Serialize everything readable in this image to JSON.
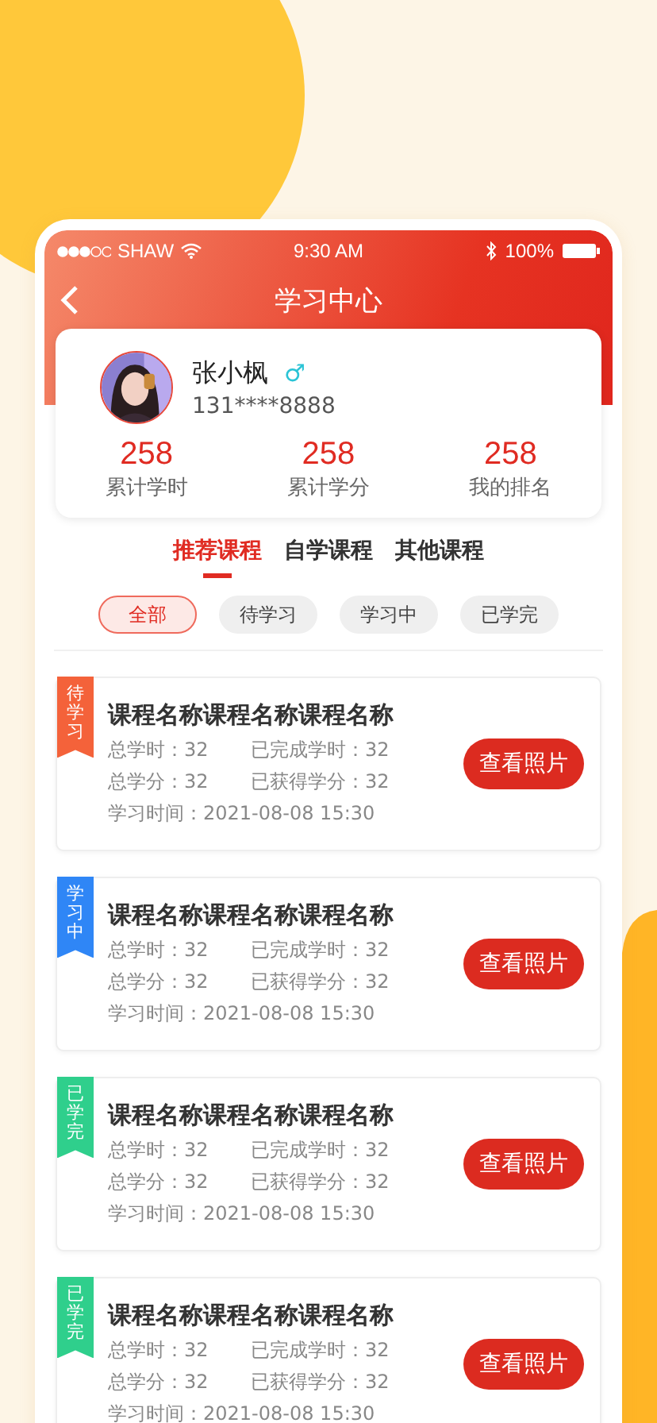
{
  "status_bar": {
    "carrier": "SHAW",
    "time": "9:30 AM",
    "battery": "100%"
  },
  "header": {
    "title": "学习中心"
  },
  "profile": {
    "name": "张小枫",
    "gender": "♂",
    "phone": "131****8888",
    "stats": [
      {
        "value": "258",
        "label": "累计学时"
      },
      {
        "value": "258",
        "label": "累计学分"
      },
      {
        "value": "258",
        "label": "我的排名"
      }
    ]
  },
  "tabs": [
    {
      "label": "推荐课程",
      "selected": true
    },
    {
      "label": "自学课程",
      "selected": false
    },
    {
      "label": "其他课程",
      "selected": false
    }
  ],
  "filters": [
    {
      "label": "全部",
      "selected": true
    },
    {
      "label": "待学习",
      "selected": false
    },
    {
      "label": "学习中",
      "selected": false
    },
    {
      "label": "已学完",
      "selected": false
    }
  ],
  "courses": [
    {
      "status": "待学习",
      "color": "#f4623a",
      "title": "课程名称课程名称课程名称",
      "total_hours": "总学时：32",
      "done_hours": "已完成学时：32",
      "total_credits": "总学分：32",
      "earned_credits": "已获得学分：32",
      "time": "学习时间：2021-08-08 15:30",
      "button": "查看照片"
    },
    {
      "status": "学习中",
      "color": "#2f86f6",
      "title": "课程名称课程名称课程名称",
      "total_hours": "总学时：32",
      "done_hours": "已完成学时：32",
      "total_credits": "总学分：32",
      "earned_credits": "已获得学分：32",
      "time": "学习时间：2021-08-08 15:30",
      "button": "查看照片"
    },
    {
      "status": "已学完",
      "color": "#2fcf8c",
      "title": "课程名称课程名称课程名称",
      "total_hours": "总学时：32",
      "done_hours": "已完成学时：32",
      "total_credits": "总学分：32",
      "earned_credits": "已获得学分：32",
      "time": "学习时间：2021-08-08 15:30",
      "button": "查看照片"
    },
    {
      "status": "已学完",
      "color": "#2fcf8c",
      "title": "课程名称课程名称课程名称",
      "total_hours": "总学时：32",
      "done_hours": "已完成学时：32",
      "total_credits": "总学分：32",
      "earned_credits": "已获得学分：32",
      "time": "学习时间：2021-08-08 15:30",
      "button": "查看照片"
    }
  ]
}
